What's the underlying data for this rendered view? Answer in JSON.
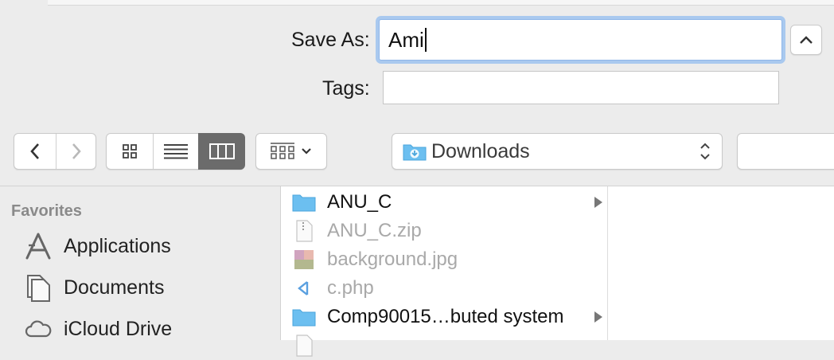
{
  "save_as": {
    "label": "Save As:",
    "value": "Ami"
  },
  "tags": {
    "label": "Tags:",
    "value": ""
  },
  "toolbar": {
    "back_icon": "chevron-left-icon",
    "forward_icon": "chevron-right-icon",
    "view_modes": [
      "icon-view",
      "list-view",
      "column-view"
    ],
    "selected_view": "column-view",
    "arrange_icon": "arrange-grid-icon",
    "location": "Downloads"
  },
  "sidebar": {
    "header": "Favorites",
    "items": [
      {
        "label": "Applications",
        "icon": "applications-icon"
      },
      {
        "label": "Documents",
        "icon": "documents-icon"
      },
      {
        "label": "iCloud Drive",
        "icon": "icloud-icon"
      }
    ]
  },
  "files": [
    {
      "name": "ANU_C",
      "kind": "folder",
      "enabled": true,
      "has_children": true
    },
    {
      "name": "ANU_C.zip",
      "kind": "zip",
      "enabled": false,
      "has_children": false
    },
    {
      "name": "background.jpg",
      "kind": "image",
      "enabled": false,
      "has_children": false
    },
    {
      "name": "c.php",
      "kind": "code",
      "enabled": false,
      "has_children": false
    },
    {
      "name": "Comp90015…buted system",
      "kind": "folder",
      "enabled": true,
      "has_children": true
    }
  ],
  "colors": {
    "focus_ring": "#a9c9ef",
    "folder_blue": "#6cbff0",
    "selected_segment": "#6b6b6b"
  }
}
